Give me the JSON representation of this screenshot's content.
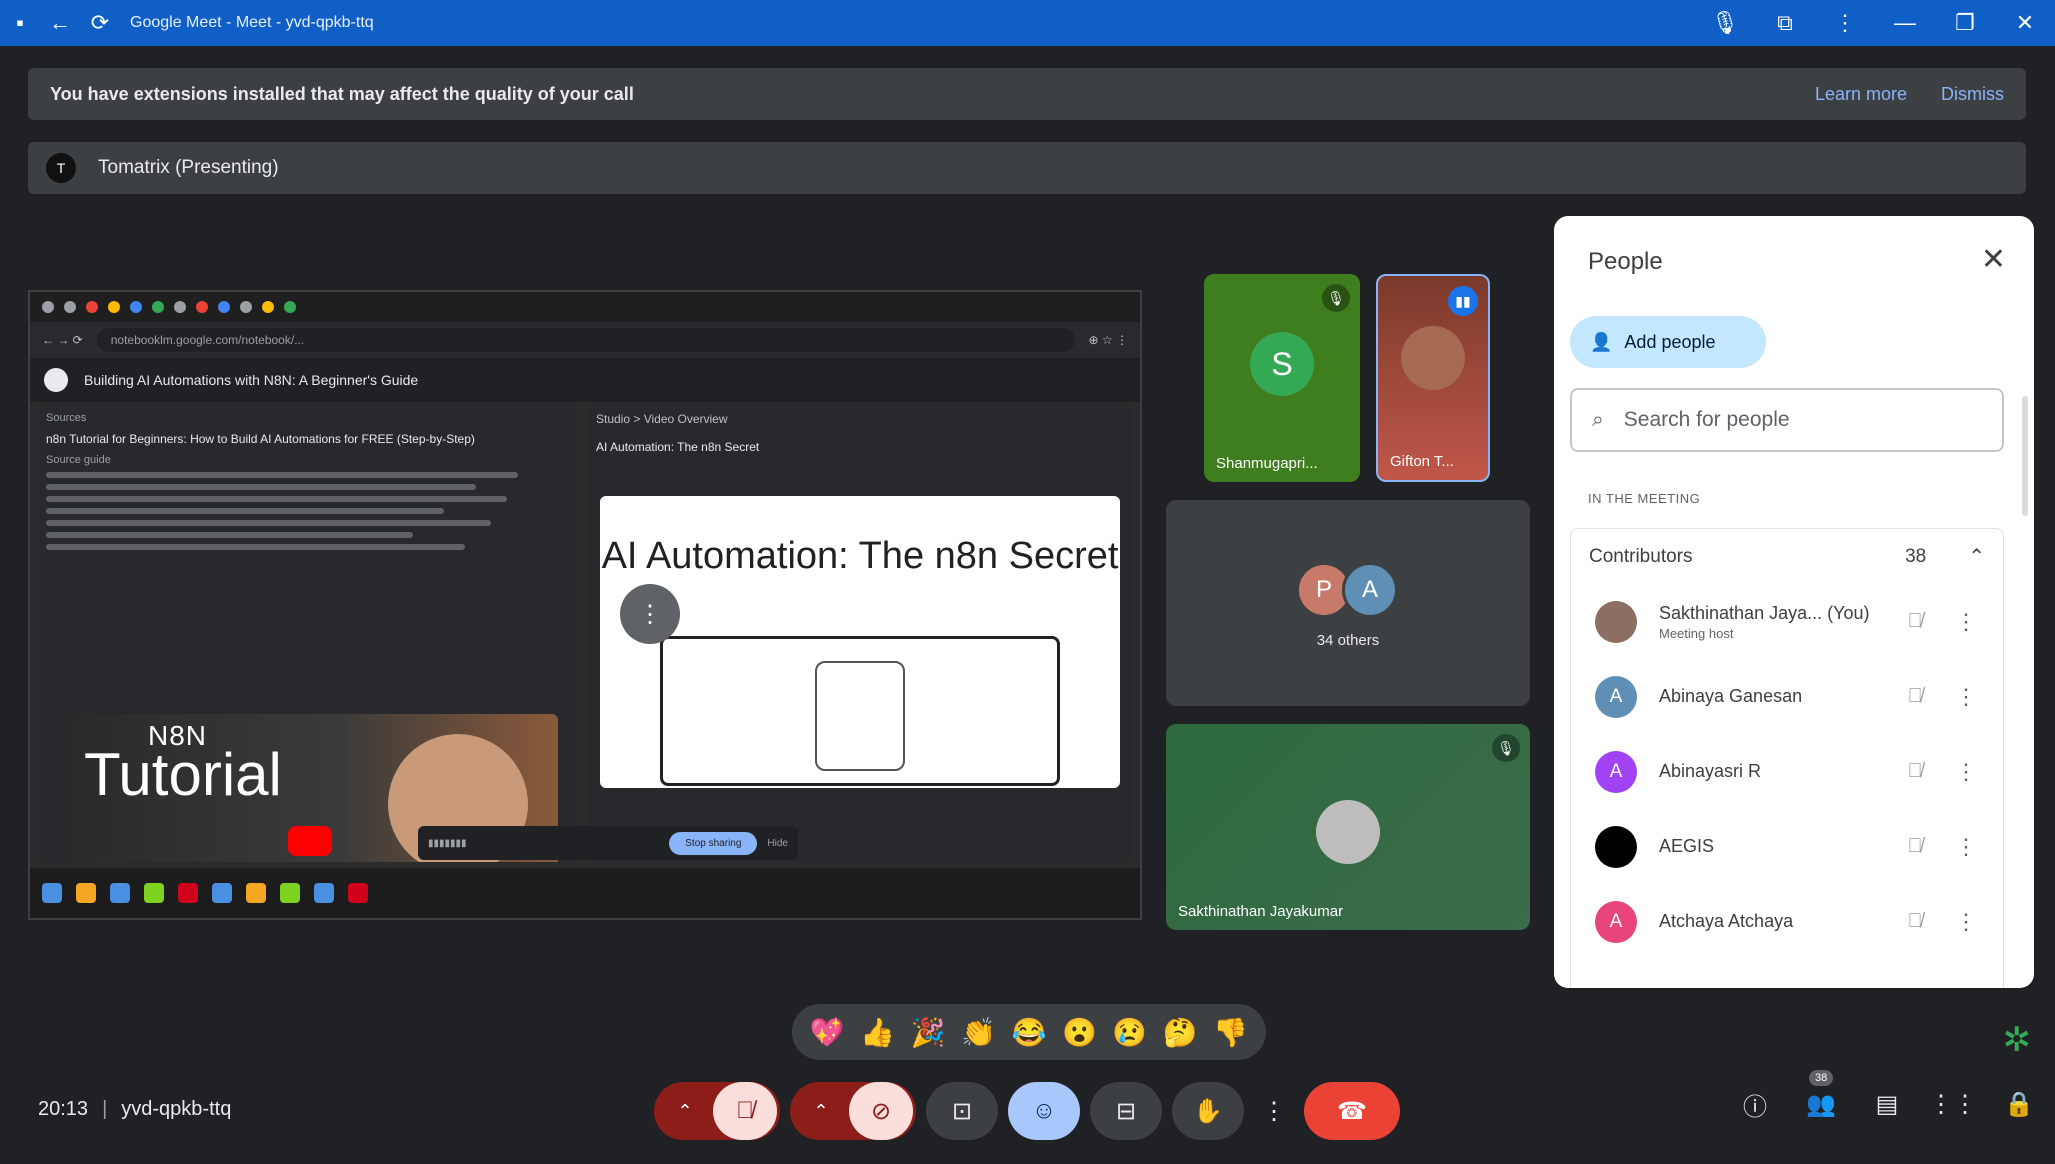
{
  "titlebar": {
    "title": "Google Meet - Meet - yvd-qpkb-ttq"
  },
  "banner": {
    "message": "You have extensions installed that may affect the quality of your call",
    "learn_more": "Learn more",
    "dismiss": "Dismiss"
  },
  "presenting": {
    "label": "Tomatrix (Presenting)",
    "avatar_letter": "T"
  },
  "screen": {
    "url": "notebooklm.google.com/notebook/...",
    "notebook_title": "Building AI Automations with N8N: A Beginner's Guide",
    "panel_left_title": "Sources",
    "source_title": "n8n Tutorial for Beginners: How to Build AI Automations for FREE (Step-by-Step)",
    "guide_label": "Source guide",
    "panel_right_title": "Studio > Video Overview",
    "video_title": "AI Automation: The n8n Secret",
    "video_heading": "AI Automation: The n8n Secret",
    "yt_n8n": "N8N",
    "yt_tutorial": "Tutorial",
    "share_stop": "Stop sharing",
    "share_hide": "Hide"
  },
  "tiles": {
    "shanmugapriya": {
      "letter": "S",
      "name": "Shanmugapri..."
    },
    "gifton": {
      "name": "Gifton T..."
    },
    "others": {
      "letters": [
        "P",
        "A"
      ],
      "label": "34 others"
    },
    "sakthinathan": {
      "name": "Sakthinathan Jayakumar"
    }
  },
  "people_panel": {
    "title": "People",
    "add_people": "Add people",
    "search_placeholder": "Search for people",
    "section": "IN THE MEETING",
    "contributors_label": "Contributors",
    "contributors_count": "38",
    "participants": [
      {
        "name": "Sakthinathan Jaya... (You)",
        "sub": "Meeting host",
        "letter": "",
        "color": "#8d6e63"
      },
      {
        "name": "Abinaya Ganesan",
        "sub": "",
        "letter": "A",
        "color": "#5f8fb4"
      },
      {
        "name": "Abinayasri R",
        "sub": "",
        "letter": "A",
        "color": "#a142f4"
      },
      {
        "name": "AEGIS",
        "sub": "",
        "letter": "",
        "color": "#000000"
      },
      {
        "name": "Atchaya Atchaya",
        "sub": "",
        "letter": "A",
        "color": "#e8457a"
      }
    ]
  },
  "reactions": [
    "💖",
    "👍",
    "🎉",
    "👏",
    "😂",
    "😮",
    "😢",
    "🤔",
    "👎"
  ],
  "bottom": {
    "time": "20:13",
    "separator": "|",
    "meeting_code": "yvd-qpkb-ttq",
    "people_badge": "38"
  },
  "colors": {
    "accent": "#a8c7fa",
    "hangup": "#ea4335",
    "muted_bg": "#f9dedc"
  }
}
